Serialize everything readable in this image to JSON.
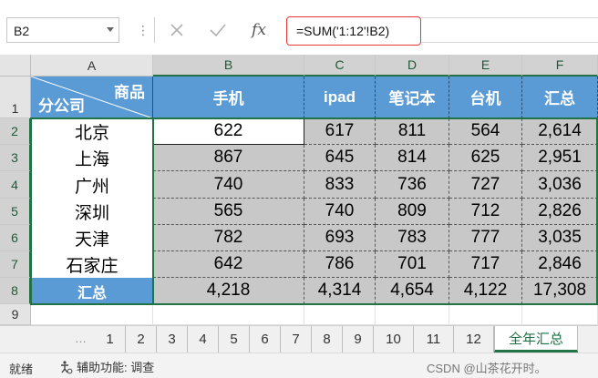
{
  "name_box": "B2",
  "formula": "=SUM('1:12'!B2)",
  "columns": [
    "A",
    "B",
    "C",
    "D",
    "E",
    "F"
  ],
  "rows": [
    "1",
    "2",
    "3",
    "4",
    "5",
    "6",
    "7",
    "8",
    "9"
  ],
  "header": {
    "a1_top": "商品",
    "a1_bottom": "分公司",
    "cols": [
      "手机",
      "ipad",
      "笔记本",
      "台机",
      "汇总"
    ]
  },
  "data_rows": [
    {
      "label": "北京",
      "values": [
        "622",
        "617",
        "811",
        "564",
        "2,614"
      ]
    },
    {
      "label": "上海",
      "values": [
        "867",
        "645",
        "814",
        "625",
        "2,951"
      ]
    },
    {
      "label": "广州",
      "values": [
        "740",
        "833",
        "736",
        "727",
        "3,036"
      ]
    },
    {
      "label": "深圳",
      "values": [
        "565",
        "740",
        "809",
        "712",
        "2,826"
      ]
    },
    {
      "label": "天津",
      "values": [
        "782",
        "693",
        "783",
        "777",
        "3,035"
      ]
    },
    {
      "label": "石家庄",
      "values": [
        "642",
        "786",
        "701",
        "717",
        "2,846"
      ]
    }
  ],
  "total_row": {
    "label": "汇总",
    "values": [
      "4,218",
      "4,314",
      "4,654",
      "4,122",
      "17,308"
    ]
  },
  "sheet_tabs": [
    "1",
    "2",
    "3",
    "4",
    "5",
    "6",
    "7",
    "8",
    "9",
    "10",
    "11",
    "12",
    "全年汇总"
  ],
  "active_tab": "全年汇总",
  "status": {
    "ready": "就绪",
    "accessibility": "辅助功能: 调查"
  },
  "watermark": "CSDN @山茶花开时。",
  "colors": {
    "header_blue": "#5b9bd5",
    "selection_green": "#217346",
    "group_gray": "#c8c8c8"
  }
}
